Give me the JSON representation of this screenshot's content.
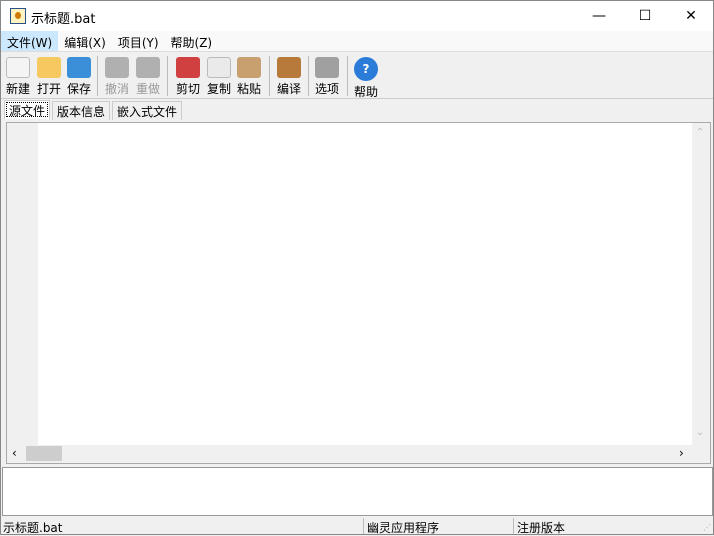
{
  "window": {
    "title": "示标题.bat",
    "minimize": "—",
    "maximize": "☐",
    "close": "✕"
  },
  "menu": [
    {
      "label": "文件(W)"
    },
    {
      "label": "编辑(X)"
    },
    {
      "label": "项目(Y)"
    },
    {
      "label": "帮助(Z)"
    }
  ],
  "toolbar": [
    {
      "label": "新建",
      "icon": "new-file-icon",
      "color": "#f4f4f4"
    },
    {
      "label": "打开",
      "icon": "open-folder-icon",
      "color": "#f5c860"
    },
    {
      "label": "保存",
      "icon": "save-icon",
      "color": "#3a8fd8"
    },
    {
      "label": "撤消",
      "icon": "undo-icon",
      "color": "#b0b0b0",
      "disabled": true
    },
    {
      "label": "重做",
      "icon": "redo-icon",
      "color": "#b0b0b0",
      "disabled": true
    },
    {
      "label": "剪切",
      "icon": "cut-icon",
      "color": "#d04040"
    },
    {
      "label": "复制",
      "icon": "copy-icon",
      "color": "#eaeaea"
    },
    {
      "label": "粘贴",
      "icon": "paste-icon",
      "color": "#c8a070"
    },
    {
      "label": "编译",
      "icon": "compile-icon",
      "color": "#b87a3a"
    },
    {
      "label": "选项",
      "icon": "options-gear-icon",
      "color": "#a0a0a0"
    },
    {
      "label": "帮助",
      "icon": "help-icon",
      "color": "#2b7bd8"
    }
  ],
  "tabs": [
    {
      "label": "源文件"
    },
    {
      "label": "版本信息"
    },
    {
      "label": "嵌入式文件"
    }
  ],
  "status": {
    "file": "示标题.bat",
    "app": "幽灵应用程序",
    "license": "注册版本"
  }
}
